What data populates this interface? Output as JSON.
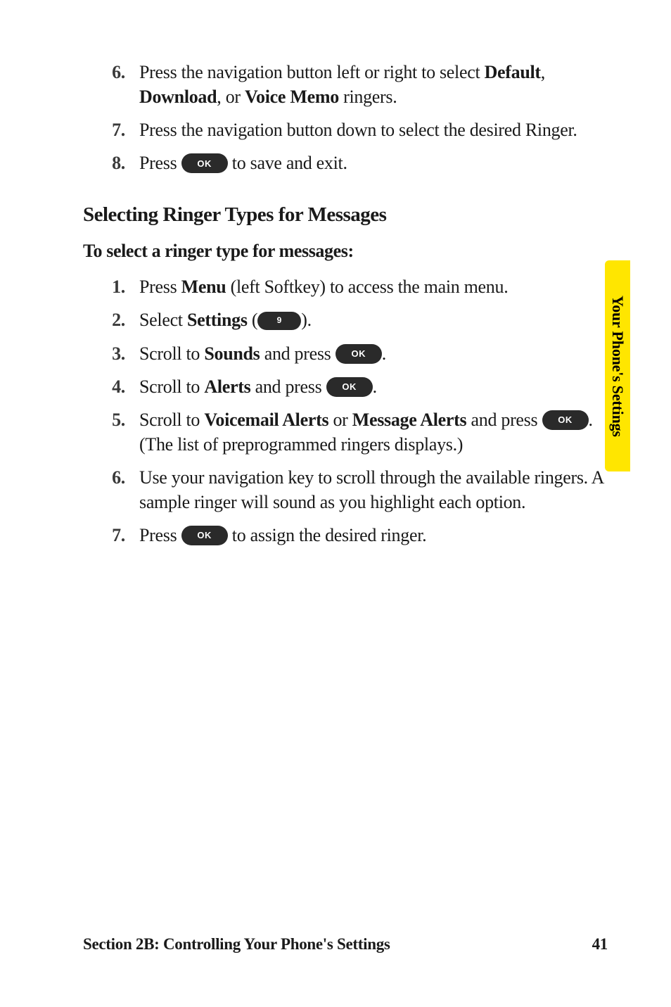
{
  "keys": {
    "ok": "OK",
    "nine": "9"
  },
  "listA": [
    {
      "num": "6.",
      "parts": [
        "Press the navigation button left or right to select ",
        {
          "b": "Default"
        },
        ", ",
        {
          "b": "Download"
        },
        ", or ",
        {
          "b": "Voice Memo"
        },
        " ringers."
      ]
    },
    {
      "num": "7.",
      "parts": [
        "Press the navigation button down to select the desired Ringer."
      ]
    },
    {
      "num": "8.",
      "parts": [
        "Press ",
        {
          "key": "ok"
        },
        " to save and exit."
      ]
    }
  ],
  "subhead": "Selecting Ringer Types for Messages",
  "intro": "To select a ringer type for messages:",
  "listB": [
    {
      "num": "1.",
      "parts": [
        "Press ",
        {
          "b": "Menu"
        },
        " (left Softkey) to access the main menu."
      ]
    },
    {
      "num": "2.",
      "parts": [
        "Select ",
        {
          "b": "Settings"
        },
        " (",
        {
          "key": "nine"
        },
        ")."
      ]
    },
    {
      "num": "3.",
      "parts": [
        "Scroll to ",
        {
          "b": "Sounds"
        },
        " and press ",
        {
          "key": "ok"
        },
        "."
      ]
    },
    {
      "num": "4.",
      "parts": [
        "Scroll to ",
        {
          "b": "Alerts"
        },
        " and press ",
        {
          "key": "ok"
        },
        "."
      ]
    },
    {
      "num": "5.",
      "parts": [
        "Scroll to ",
        {
          "b": "Voicemail Alerts"
        },
        " or ",
        {
          "b": "Message Alerts"
        },
        " and press ",
        {
          "key": "ok"
        },
        ". (The list of preprogrammed ringers displays.)"
      ]
    },
    {
      "num": "6.",
      "parts": [
        "Use your navigation key to scroll through the available ringers. A sample ringer will sound as you highlight each option."
      ]
    },
    {
      "num": "7.",
      "parts": [
        "Press ",
        {
          "key": "ok"
        },
        " to assign the desired ringer."
      ]
    }
  ],
  "tab": "Your Phone's Settings",
  "footer_left": "Section 2B: Controlling Your Phone's Settings",
  "footer_right": "41"
}
